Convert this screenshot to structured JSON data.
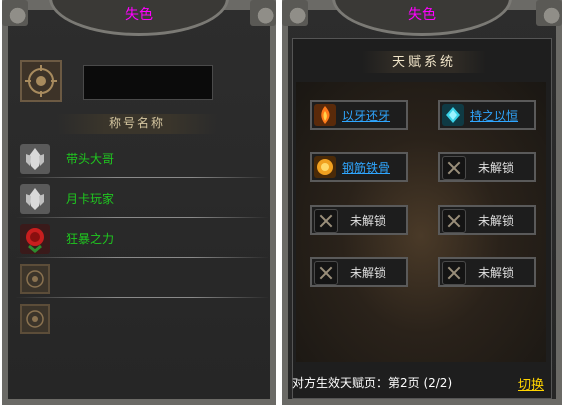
{
  "left_panel": {
    "title": "失色",
    "section_title": "称号名称",
    "titles": [
      {
        "label": "带头大哥",
        "icon": "silver-wings-icon"
      },
      {
        "label": "月卡玩家",
        "icon": "silver-wings-icon"
      },
      {
        "label": "狂暴之力",
        "icon": "red-rose-icon"
      },
      {
        "label": "",
        "icon": "empty-slot-icon"
      },
      {
        "label": "",
        "icon": "empty-slot-icon"
      }
    ]
  },
  "right_panel": {
    "title": "失色",
    "header": "天赋系统",
    "talents": [
      {
        "label": "以牙还牙",
        "state": "unlocked",
        "icon": "fire-fang-icon"
      },
      {
        "label": "持之以恒",
        "state": "unlocked",
        "icon": "cyan-crystal-icon"
      },
      {
        "label": "钢筋铁骨",
        "state": "unlocked",
        "icon": "golden-armor-icon"
      },
      {
        "label": "未解锁",
        "state": "locked",
        "icon": "lock-icon"
      },
      {
        "label": "未解锁",
        "state": "locked",
        "icon": "lock-icon"
      },
      {
        "label": "未解锁",
        "state": "locked",
        "icon": "lock-icon"
      },
      {
        "label": "未解锁",
        "state": "locked",
        "icon": "lock-icon"
      },
      {
        "label": "未解锁",
        "state": "locked",
        "icon": "lock-icon"
      }
    ],
    "footer_text": "对方生效天赋页：第2页  (2/2)",
    "switch_label": "切换"
  },
  "colors": {
    "title": "#ff00ff",
    "title_text_green": "#1fc91f",
    "talent_unlocked_blue": "#2fa6ff",
    "switch_yellow": "#ffd400"
  }
}
